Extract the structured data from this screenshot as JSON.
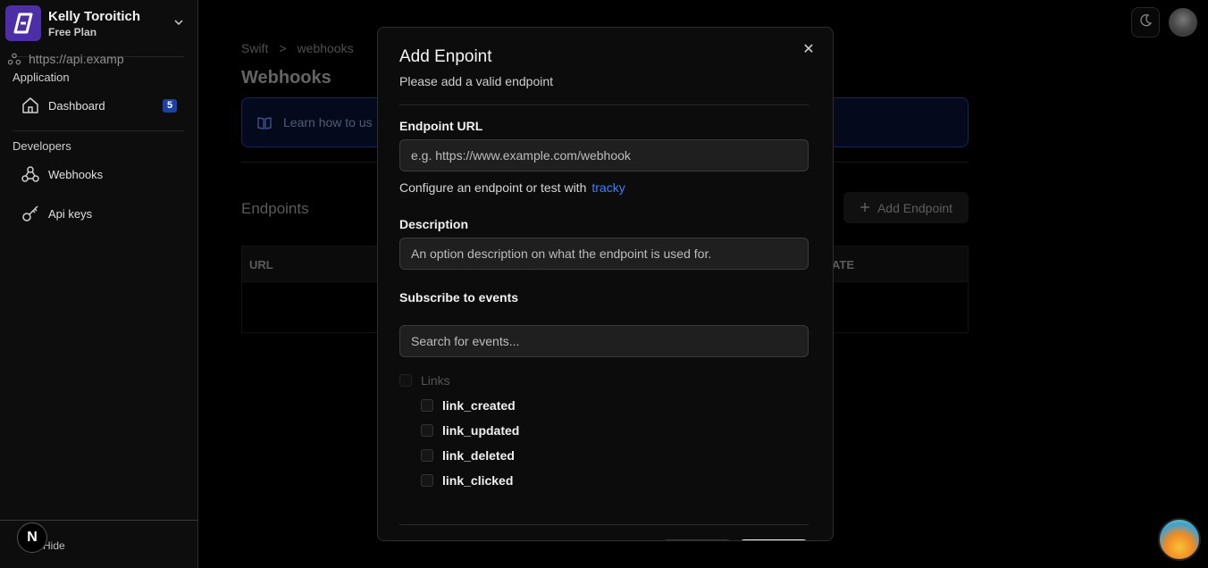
{
  "account": {
    "name": "Kelly Toroitich",
    "plan": "Free Plan"
  },
  "sidebar": {
    "sections": [
      {
        "label": "Application",
        "items": [
          {
            "label": "Dashboard",
            "icon": "home-icon",
            "badge": "5"
          }
        ]
      },
      {
        "label": "Developers",
        "items": [
          {
            "label": "Webhooks",
            "icon": "webhook-icon"
          },
          {
            "label": "Api keys",
            "icon": "key-icon"
          }
        ]
      }
    ],
    "hide_label": "Hide",
    "framework_badge": "N"
  },
  "breadcrumb": [
    "Swift",
    ">",
    "webhooks"
  ],
  "page": {
    "title": "Webhooks",
    "info_text": "Learn how to us",
    "endpoints_heading": "Endpoints",
    "add_endpoint_label": "Add Endpoint",
    "table": {
      "headers": [
        "URL",
        "ATE"
      ],
      "rows": [
        {
          "url": "https://api.examp"
        }
      ]
    }
  },
  "modal": {
    "title": "Add Enpoint",
    "subtitle": "Please add a valid endpoint",
    "close_glyph": "✕",
    "endpoint_label": "Endpoint URL",
    "endpoint_placeholder": "e.g. https://www.example.com/webhook",
    "help_text": "Configure an endpoint or test with",
    "help_link": "tracky",
    "description_label": "Description",
    "description_placeholder": "An option description on what the endpoint is used for.",
    "events_label": "Subscribe to events",
    "events_search_placeholder": "Search for events...",
    "event_group": "Links",
    "events": [
      "link_created",
      "link_updated",
      "link_deleted",
      "link_clicked"
    ]
  },
  "colors": {
    "accent": "#3b82f6",
    "badge": "#1d3fa8",
    "logo": "#4c2fa6"
  }
}
